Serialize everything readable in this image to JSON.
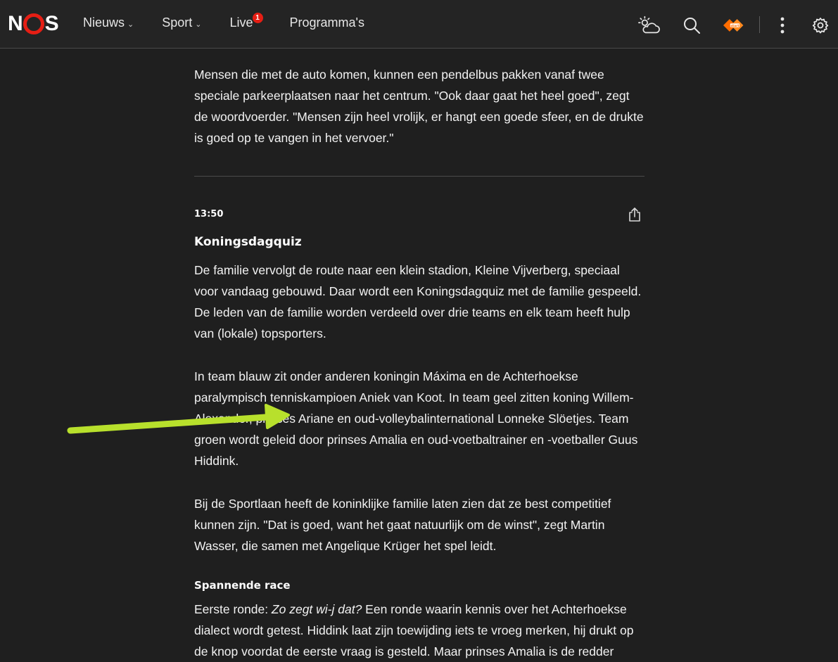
{
  "header": {
    "logo": {
      "letters": [
        "N",
        "S"
      ],
      "aria": "NOS"
    },
    "nav": [
      {
        "label": "Nieuws",
        "has_dropdown": true
      },
      {
        "label": "Sport",
        "has_dropdown": true
      },
      {
        "label": "Live",
        "badge": "1"
      },
      {
        "label": "Programma's"
      }
    ],
    "icons": [
      "weather-icon",
      "search-icon",
      "npo-start-icon",
      "more-vertical-icon",
      "settings-icon"
    ]
  },
  "article": {
    "intro_paragraph": "Mensen die met de auto komen, kunnen een pendelbus pakken vanaf twee speciale parkeerplaatsen naar het centrum. \"Ook daar gaat het heel goed\", zegt de woordvoerder. \"Mensen zijn heel vrolijk, er hangt een goede sfeer, en de drukte is goed op te vangen in het vervoer.\"",
    "update": {
      "time": "13:50",
      "title": "Koningsdagquiz",
      "paragraphs": [
        "De familie vervolgt de route naar een klein stadion, Kleine Vijverberg, speciaal voor vandaag gebouwd. Daar wordt een Koningsdagquiz met de familie gespeeld. De leden van de familie worden verdeeld over drie teams en elk team heeft hulp van (lokale) topsporters.",
        "In team blauw zit onder anderen koningin Máxima en de Achterhoekse paralympisch tenniskampioen Aniek van Koot. In team geel zitten koning Willem-Alexander, prinses Ariane en oud-volleybalinternational Lonneke Slöetjes. Team groen wordt geleid door prinses Amalia en oud-voetbaltrainer en -voetballer Guus Hiddink.",
        "Bij de Sportlaan heeft de koninklijke familie laten zien dat ze best competitief kunnen zijn. \"Dat is goed, want het gaat natuurlijk om de winst\", zegt Martin Wasser, die samen met Angelique Krüger het spel leidt."
      ],
      "subheading": "Spannende race",
      "last_paragraph": {
        "lead": "Eerste ronde: ",
        "italic": "Zo zegt wi-j dat?",
        "rest": " Een ronde waarin kennis over het Achterhoekse dialect wordt getest. Hiddink laat zijn toewijding iets te vroeg merken, hij drukt op de knop voordat de eerste vraag is gesteld. Maar prinses Amalia is de redder"
      }
    }
  },
  "annotation": {
    "type": "arrow",
    "color": "#b8e02c"
  },
  "colors": {
    "brand_red": "#e61e14",
    "background": "#1f1f1f",
    "text": "#f2f2f2"
  }
}
